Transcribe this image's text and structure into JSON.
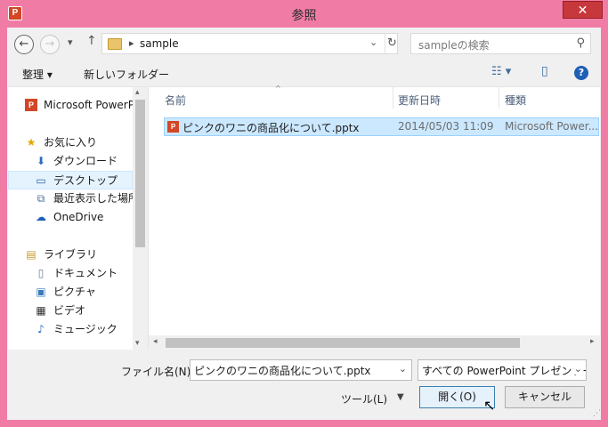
{
  "window": {
    "title": "参照",
    "app_icon_text": "P"
  },
  "nav": {
    "back_glyph": "←",
    "forward_glyph": "→",
    "recent_glyph": "▾",
    "up_glyph": "↑",
    "breadcrumb_sep": "▸",
    "address": "sample",
    "address_drop_glyph": "⌄",
    "refresh_glyph": "↻",
    "search_placeholder": "sampleの検索",
    "search_glyph": "⚲"
  },
  "toolbar": {
    "organize": "整理 ▾",
    "new_folder": "新しいフォルダー",
    "view_glyph": "☷ ▾",
    "pane_glyph": "▯",
    "help_glyph": "?"
  },
  "sidebar": {
    "items": [
      {
        "label": "Microsoft PowerPoint",
        "icon": "P"
      },
      {
        "label": "お気に入り",
        "icon": "★"
      },
      {
        "label": "ダウンロード",
        "icon": "⬇"
      },
      {
        "label": "デスクトップ",
        "icon": "▭"
      },
      {
        "label": "最近表示した場所",
        "icon": "⧉"
      },
      {
        "label": "OneDrive",
        "icon": "☁"
      },
      {
        "label": "ライブラリ",
        "icon": "▤"
      },
      {
        "label": "ドキュメント",
        "icon": "▯"
      },
      {
        "label": "ピクチャ",
        "icon": "▣"
      },
      {
        "label": "ビデオ",
        "icon": "▦"
      },
      {
        "label": "ミュージック",
        "icon": "♪"
      }
    ],
    "scroll_up": "▴",
    "scroll_down": "▾"
  },
  "files": {
    "columns": [
      "名前",
      "更新日時",
      "種類"
    ],
    "sort_glyph": "^",
    "rows": [
      {
        "name": "ピンクのワニの商品化について.pptx",
        "modified": "2014/05/03 11:09",
        "type": "Microsoft Power...",
        "icon": "P"
      }
    ],
    "scroll_left": "◂",
    "scroll_right": "▸"
  },
  "footer": {
    "filename_label": "ファイル名(N):",
    "filename_value": "ピンクのワニの商品化について.pptx",
    "filename_drop_glyph": "⌄",
    "filetype_value": "すべての PowerPoint プレゼンテーション",
    "filetype_drop_glyph": "⌄",
    "tools": "ツール(L)",
    "tools_drop_glyph": "▼",
    "open": "開く(O)",
    "cancel": "キャンセル",
    "cursor_glyph": "↖",
    "grip_glyph": "⋰"
  },
  "colors": {
    "frame": "#f07ca6",
    "selection": "#cce8ff",
    "close": "#c7383c",
    "powerpoint": "#d24726"
  }
}
